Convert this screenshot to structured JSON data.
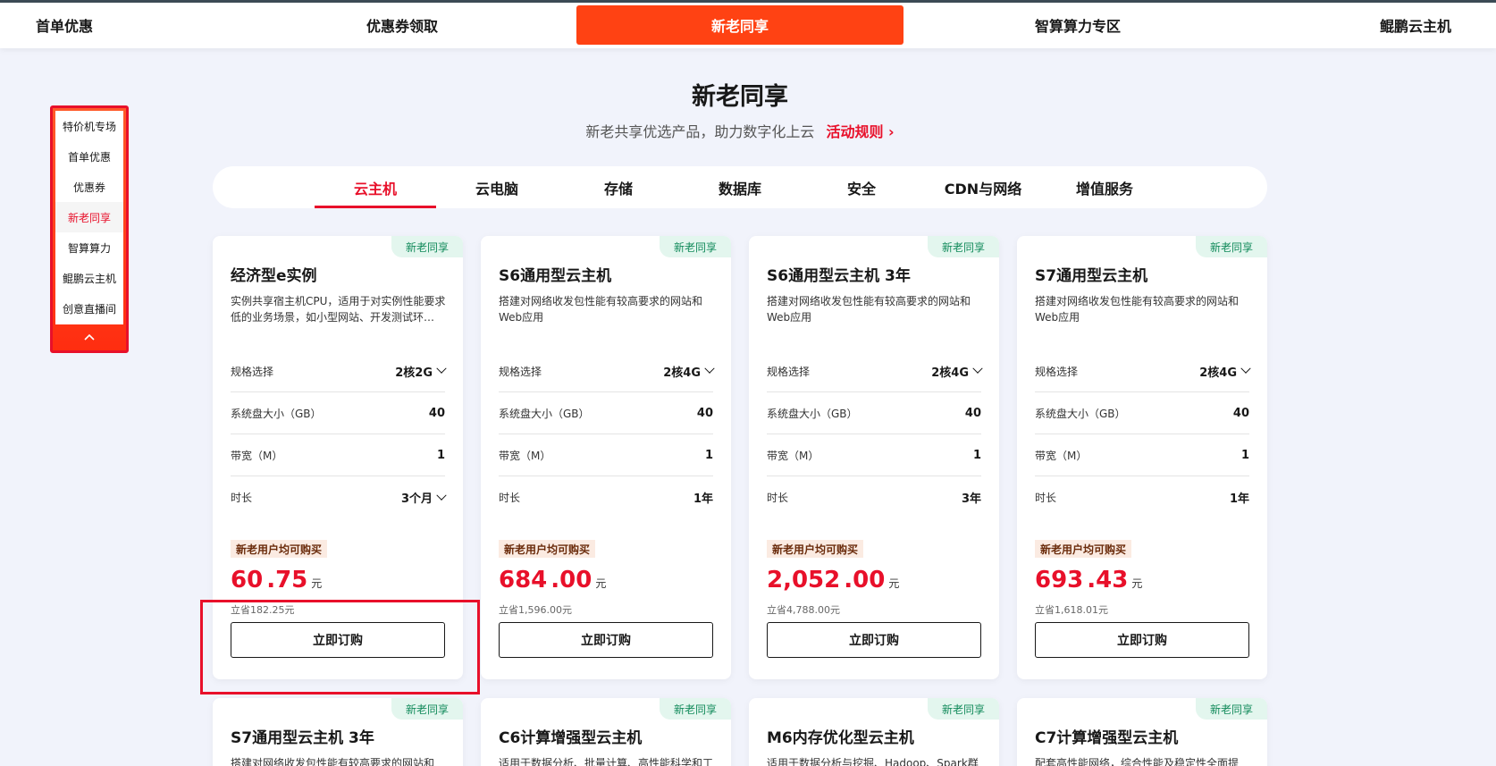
{
  "topnav": {
    "items": [
      "首单优惠",
      "优惠券领取",
      "新老同享",
      "智算算力专区",
      "鲲鹏云主机"
    ],
    "active_index": 2
  },
  "sidemenu": {
    "items": [
      "特价机专场",
      "首单优惠",
      "优惠券",
      "新老同享",
      "智算算力",
      "鲲鹏云主机",
      "创意直播间"
    ],
    "active_index": 3,
    "collapse_icon": "chevron-up-icon"
  },
  "section": {
    "title": "新老同享",
    "subtitle": "新老共享优选产品，助力数字化上云",
    "rules_link": "活动规则"
  },
  "tabs": {
    "items": [
      "云主机",
      "云电脑",
      "存储",
      "数据库",
      "安全",
      "CDN与网络",
      "增值服务"
    ],
    "active_index": 0
  },
  "labels": {
    "spec": "规格选择",
    "disk": "系统盘大小（GB）",
    "bandwidth": "带宽（M）",
    "duration": "时长",
    "badge": "新老用户均可购买",
    "currency": "元",
    "order_button": "立即订购",
    "tag": "新老同享"
  },
  "cards": [
    {
      "title": "经济型e实例",
      "desc": "实例共享宿主机CPU，适用于对实例性能要求低的业务场景，如小型网站、开发测试环…",
      "spec": "2核2G",
      "disk": "40",
      "bandwidth": "1",
      "duration": "3个月",
      "price_int": "60",
      "price_dec": ".75",
      "saved": "立省182.25元"
    },
    {
      "title": "S6通用型云主机",
      "desc": "搭建对网络收发包性能有较高要求的网站和Web应用",
      "spec": "2核4G",
      "disk": "40",
      "bandwidth": "1",
      "duration": "1年",
      "price_int": "684",
      "price_dec": ".00",
      "saved": "立省1,596.00元"
    },
    {
      "title": "S6通用型云主机 3年",
      "desc": "搭建对网络收发包性能有较高要求的网站和Web应用",
      "spec": "2核4G",
      "disk": "40",
      "bandwidth": "1",
      "duration": "3年",
      "price_int": "2,052",
      "price_dec": ".00",
      "saved": "立省4,788.00元"
    },
    {
      "title": "S7通用型云主机",
      "desc": "搭建对网络收发包性能有较高要求的网站和Web应用",
      "spec": "2核4G",
      "disk": "40",
      "bandwidth": "1",
      "duration": "1年",
      "price_int": "693",
      "price_dec": ".43",
      "saved": "立省1,618.01元"
    }
  ],
  "cards_row2": [
    {
      "title": "S7通用型云主机 3年",
      "desc": "搭建对网络收发包性能有较高要求的网站和"
    },
    {
      "title": "C6计算增强型云主机",
      "desc": "适用于数据分析、批量计算、高性能科学和工"
    },
    {
      "title": "M6内存优化型云主机",
      "desc": "适用于数据分析与挖掘、Hadoop、Spark群"
    },
    {
      "title": "C7计算增强型云主机",
      "desc": "配套高性能网络，综合性能及稳定性全面提"
    }
  ]
}
